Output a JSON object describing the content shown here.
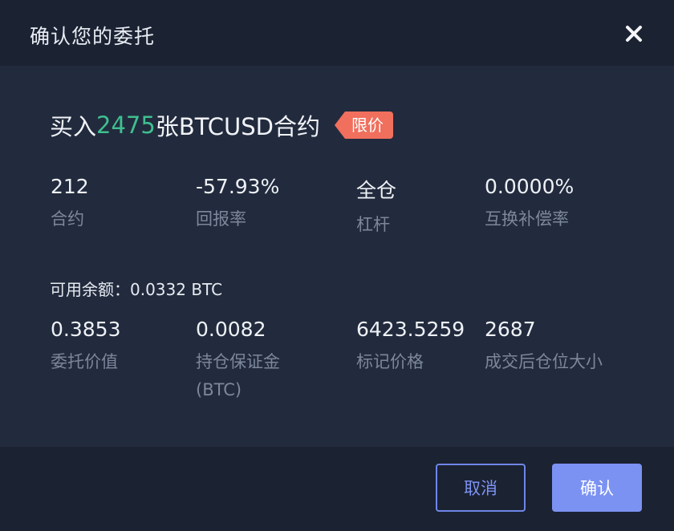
{
  "header": {
    "title": "确认您的委托"
  },
  "order": {
    "prefix": "买入",
    "quantity": "2475",
    "suffix": "张BTCUSD合约",
    "order_type_tag": "限价"
  },
  "stats_row1": [
    {
      "value": "212",
      "label": "合约"
    },
    {
      "value": "-57.93%",
      "label": "回报率"
    },
    {
      "value": "全仓",
      "label": "杠杆"
    },
    {
      "value": "0.0000%",
      "label": "互换补偿率"
    }
  ],
  "balance": {
    "text": "可用余额：0.0332 BTC"
  },
  "stats_row2": [
    {
      "value": "0.3853",
      "label": "委托价值"
    },
    {
      "value": "0.0082",
      "label": "持仓保证金",
      "label2": "(BTC)"
    },
    {
      "value": "6423.5259",
      "label": "标记价格"
    },
    {
      "value": "2687",
      "label": "成交后仓位大小"
    }
  ],
  "footer": {
    "cancel_label": "取消",
    "confirm_label": "确认"
  },
  "icons": {
    "close": "close-icon"
  },
  "colors": {
    "accent": "#7b92f2",
    "buy": "#3fbf8f",
    "tag": "#f06f5d"
  }
}
